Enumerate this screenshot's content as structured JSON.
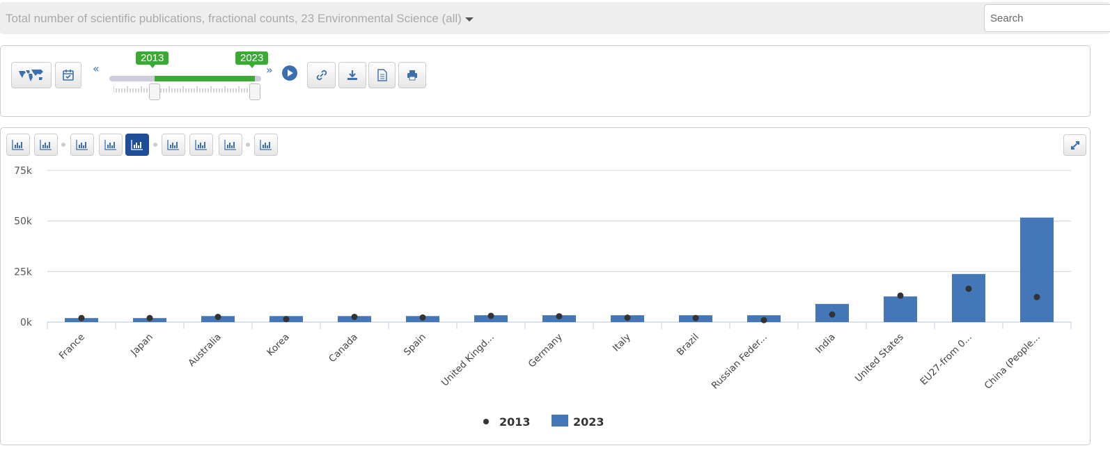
{
  "header": {
    "title": "Total number of scientific publications, fractional counts, 23 Environmental Science (all)",
    "search_placeholder": "Search"
  },
  "timeline": {
    "start_year": "2013",
    "end_year": "2023",
    "prev_label": "«",
    "next_label": "»"
  },
  "toolbar": {
    "icons": [
      "world-map-icon",
      "calendar-icon",
      "play-icon",
      "link-icon",
      "download-icon",
      "document-icon",
      "print-icon"
    ]
  },
  "chart_toolbar": {
    "icons": [
      "bar-chart-icon",
      "horizontal-bar-icon",
      "line-chart-icon",
      "area-growth-icon",
      "dot-bar-chart-icon",
      "scatter-icon",
      "multi-line-icon",
      "stacked-icon",
      "sort-icon"
    ],
    "active": "dot-bar-chart-icon"
  },
  "chart_data": {
    "type": "bar",
    "categories": [
      "France",
      "Japan",
      "Australia",
      "Korea",
      "Canada",
      "Spain",
      "United Kingd...",
      "Germany",
      "Italy",
      "Brazil",
      "Russian Feder...",
      "India",
      "United States",
      "EU27-from 0...",
      "China (People..."
    ],
    "series": [
      {
        "name": "2013",
        "kind": "dot",
        "color": "#333333",
        "values": [
          2000,
          2000,
          2600,
          1500,
          2600,
          2300,
          3100,
          2900,
          2200,
          2000,
          1000,
          3800,
          13100,
          16500,
          12400
        ]
      },
      {
        "name": "2023",
        "kind": "bar",
        "color": "#4477b8",
        "values": [
          2000,
          2000,
          3000,
          3000,
          3000,
          3000,
          3400,
          3400,
          3400,
          3400,
          3400,
          9000,
          12700,
          23800,
          51700
        ]
      }
    ],
    "yticks": [
      "0k",
      "25k",
      "50k",
      "75k"
    ],
    "ylim": [
      0,
      75000
    ],
    "grid": true,
    "legend": "bottom"
  }
}
